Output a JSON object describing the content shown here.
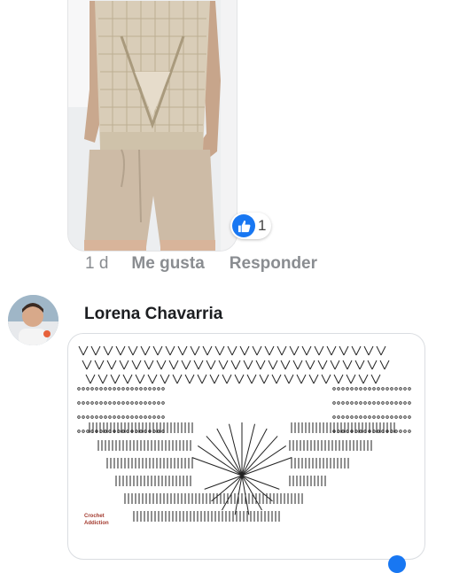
{
  "post": {
    "reaction_icon": "thumbs-up-icon",
    "reaction_count": "1",
    "time": "1 d",
    "like_label": "Me gusta",
    "reply_label": "Responder"
  },
  "comment": {
    "author": "Lorena Chavarria",
    "avatar_icon": "user-avatar",
    "diagram_watermark_line1": "Crochet",
    "diagram_watermark_line2": "Addiction"
  },
  "colors": {
    "like_blue": "#1877f2",
    "muted_text": "#8a8d91",
    "name_text": "#1c1e21"
  }
}
